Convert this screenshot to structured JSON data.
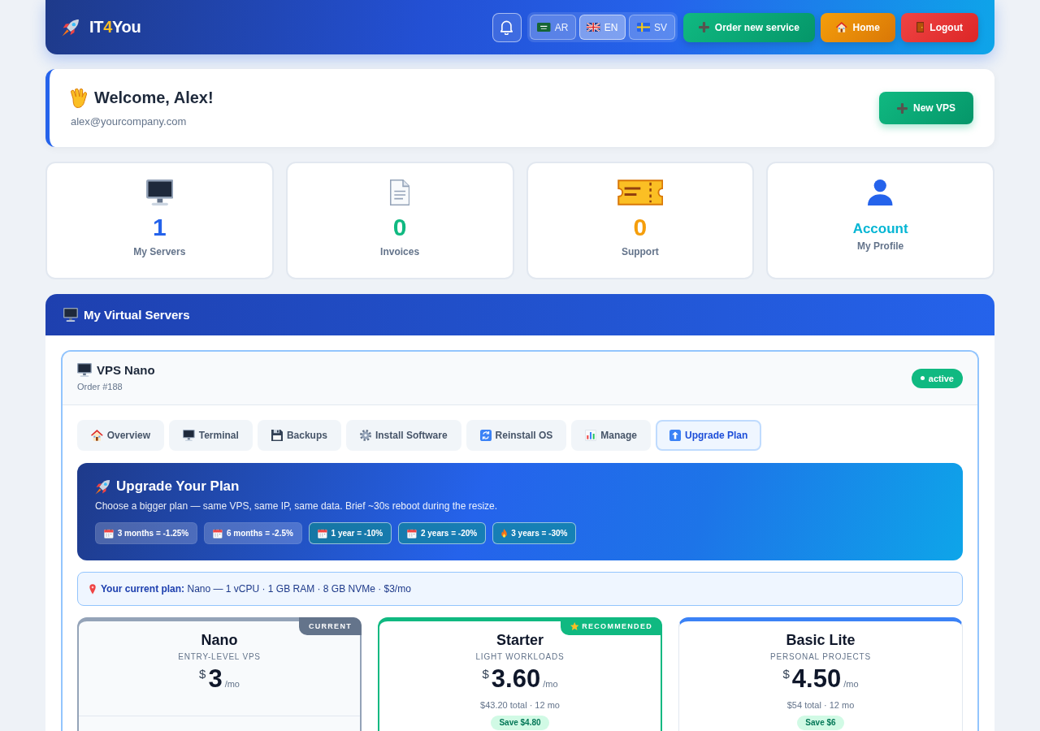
{
  "header": {
    "logo": [
      {
        "text": "IT",
        "accent": false
      },
      {
        "text": "4",
        "accent": true
      },
      {
        "text": "You",
        "accent": false
      }
    ],
    "languages": [
      {
        "label": "AR",
        "selected": false
      },
      {
        "label": "EN",
        "selected": true
      },
      {
        "label": "SV",
        "selected": false
      }
    ],
    "actions": [
      {
        "label": "Order new service",
        "kind": "order"
      },
      {
        "label": "Home",
        "kind": "home"
      },
      {
        "label": "Logout",
        "kind": "logout"
      }
    ]
  },
  "welcome": {
    "greeting": "Welcome, Alex!",
    "email": "alex@yourcompany.com",
    "action": "New VPS"
  },
  "stats": [
    {
      "kind": "count",
      "value": "1",
      "label": "My Servers",
      "color": "#2563eb"
    },
    {
      "kind": "count",
      "value": "0",
      "label": "Invoices",
      "color": "#10b981"
    },
    {
      "kind": "count",
      "value": "0",
      "label": "Support",
      "color": "#f59e0b"
    },
    {
      "kind": "link",
      "value": "Account",
      "label": "My Profile",
      "color": "#06b6d4"
    }
  ],
  "servers": {
    "title": "My Virtual Servers",
    "items": [
      {
        "name": "VPS Nano",
        "order": "Order #188",
        "status": "active",
        "tabs": [
          {
            "label": "Overview",
            "selected": false
          },
          {
            "label": "Terminal",
            "selected": false
          },
          {
            "label": "Backups",
            "selected": false
          },
          {
            "label": "Install Software",
            "selected": false
          },
          {
            "label": "Reinstall OS",
            "selected": false
          },
          {
            "label": "Manage",
            "selected": false
          },
          {
            "label": "Upgrade Plan",
            "selected": true
          }
        ],
        "upgrade": {
          "title": "Upgrade Your Plan",
          "description": "Choose a bigger plan — same VPS, same IP, same data. Brief ~30s reboot during the resize.",
          "discounts": [
            {
              "label": "3 months = -1.25%",
              "highlighted": false
            },
            {
              "label": "6 months = -2.5%",
              "highlighted": false
            },
            {
              "label": "1 year = -10%",
              "highlighted": true
            },
            {
              "label": "2 years = -20%",
              "highlighted": true
            },
            {
              "label": "3 years = -30%",
              "highlighted": true
            }
          ]
        },
        "current_plan": "**Your current plan:** Nano — 1 vCPU · 1 GB RAM · 8 GB NVMe · $3/mo",
        "plans": [
          {
            "kind": "current",
            "badge": "CURRENT",
            "name": "Nano",
            "tagline": "ENTRY-LEVEL VPS",
            "price": {
              "currency": "$",
              "amount": "3",
              "period": "/mo"
            }
          },
          {
            "kind": "recommended",
            "badge": "RECOMMENDED",
            "name": "Starter",
            "tagline": "LIGHT WORKLOADS",
            "price": {
              "currency": "$",
              "amount": "3.60",
              "period": "/mo"
            },
            "total": "$43.20 total · 12 mo",
            "savings": "Save $4.80"
          },
          {
            "kind": "standard",
            "name": "Basic Lite",
            "tagline": "PERSONAL PROJECTS",
            "price": {
              "currency": "$",
              "amount": "4.50",
              "period": "/mo"
            },
            "total": "$54 total · 12 mo",
            "savings": "Save $6"
          }
        ]
      }
    ]
  }
}
